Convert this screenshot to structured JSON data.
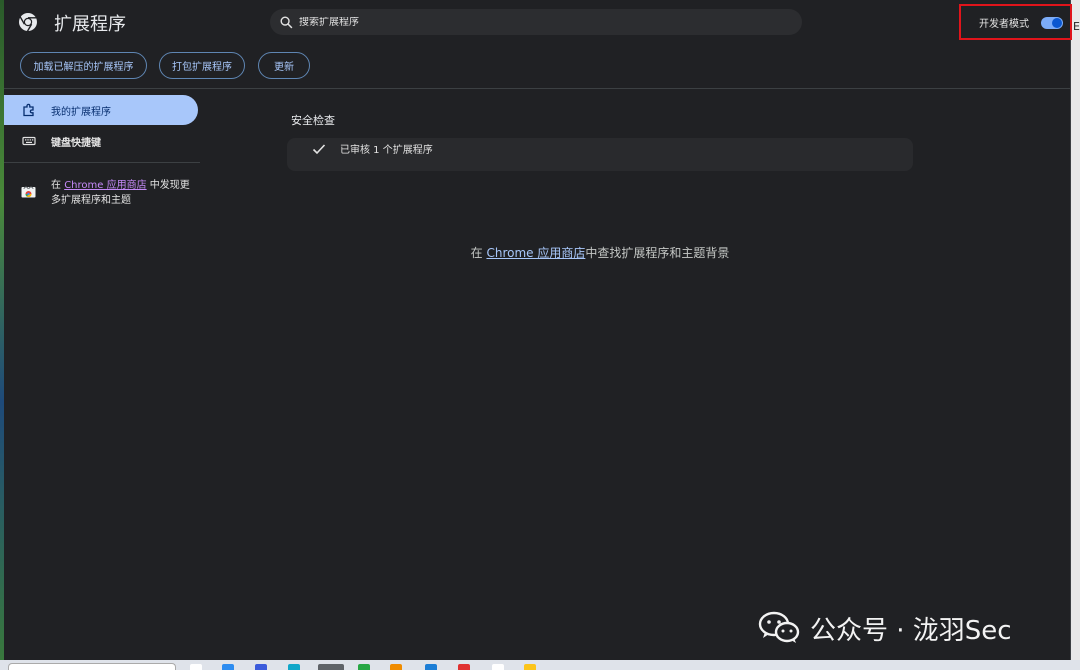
{
  "header": {
    "title": "扩展程序",
    "search_placeholder": "搜索扩展程序",
    "dev_mode_label": "开发者模式",
    "dev_mode_on": true
  },
  "toolbar": {
    "load_unpacked": "加载已解压的扩展程序",
    "pack_extension": "打包扩展程序",
    "update": "更新"
  },
  "sidebar": {
    "items": [
      {
        "label": "我的扩展程序",
        "icon": "puzzle-icon",
        "active": true
      },
      {
        "label": "键盘快捷键",
        "icon": "keyboard-icon",
        "active": false
      }
    ],
    "store_prefix": "在 ",
    "store_link": "Chrome 应用商店",
    "store_suffix": " 中发现更多扩展程序和主题"
  },
  "main": {
    "safety_title": "安全检查",
    "safety_text": "已审核 1 个扩展程序",
    "empty_prefix": "在 ",
    "empty_link": "Chrome 应用商店",
    "empty_suffix": "中查找扩展程序和主题背景"
  },
  "watermark": {
    "text": "公众号 · 泷羽Sec"
  },
  "desktop": {
    "right_edge_char": "E"
  },
  "colors": {
    "accent": "#a8c7fa",
    "highlight_box": "#e0141b",
    "background": "#202124"
  }
}
